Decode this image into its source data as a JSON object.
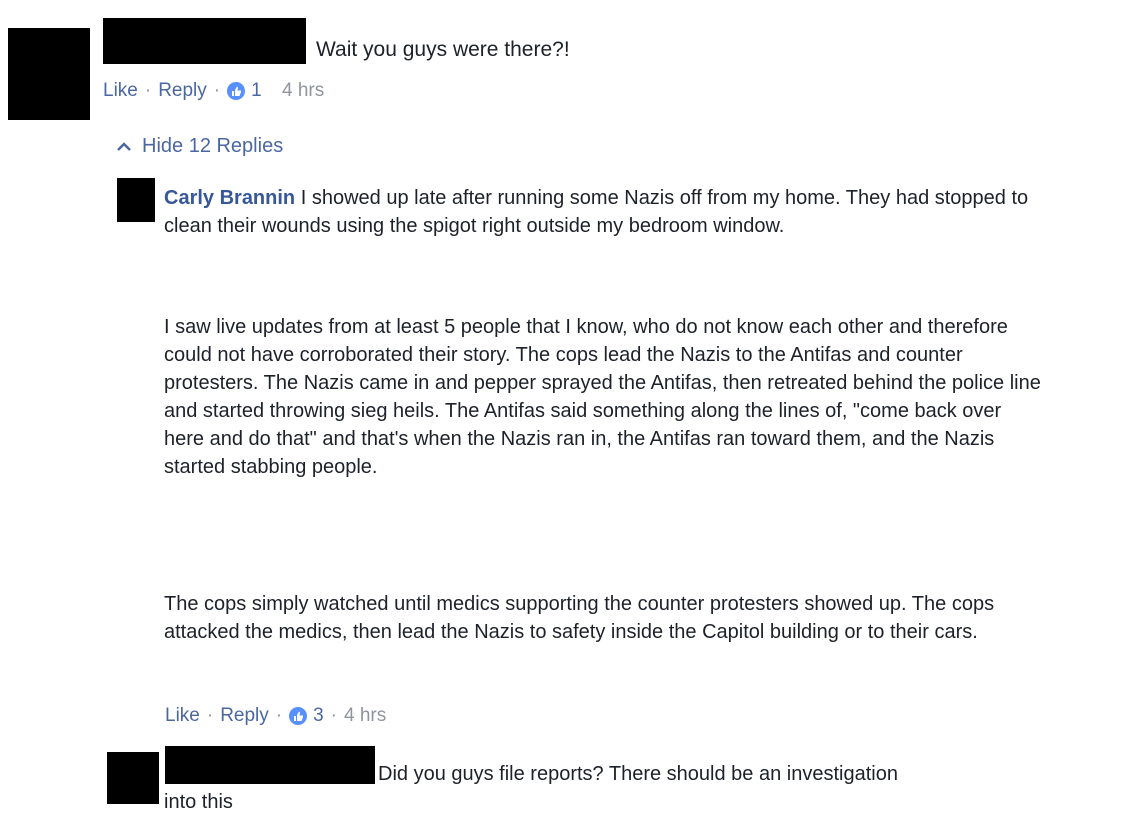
{
  "comment1": {
    "text": "Wait you guys were there?!",
    "actions": {
      "like": "Like",
      "reply": "Reply",
      "reactions": "1",
      "time": "4 hrs"
    }
  },
  "hide_replies": "Hide 12 Replies",
  "reply1": {
    "author": "Carly Brannin",
    "paragraphs": [
      "I showed up late after running some Nazis off from my home. They had stopped to clean their wounds using the spigot right outside my bedroom window.",
      "I saw live updates from at least 5 people that I know, who do not know each other and therefore could not have corroborated their story. The cops lead the Nazis to the Antifas and counter protesters. The Nazis came in and pepper sprayed the Antifas, then retreated behind the police line and started throwing sieg heils. The Antifas said something along the lines of, \"come back over here and do that\" and that's when the Nazis ran in, the Antifas ran toward them, and the Nazis started stabbing people.",
      "The cops simply watched until medics supporting the counter protesters showed up. The cops attacked the medics, then lead the Nazis to safety inside the Capitol building or to their cars."
    ],
    "actions": {
      "like": "Like",
      "reply": "Reply",
      "reactions": "3",
      "time": "4 hrs"
    }
  },
  "reply2": {
    "text": "Did you guys file reports? There should be an investigation into this"
  },
  "colors": {
    "link": "#4b67a1",
    "name": "#365899",
    "meta": "#90949c",
    "reaction": "#5890ff"
  }
}
